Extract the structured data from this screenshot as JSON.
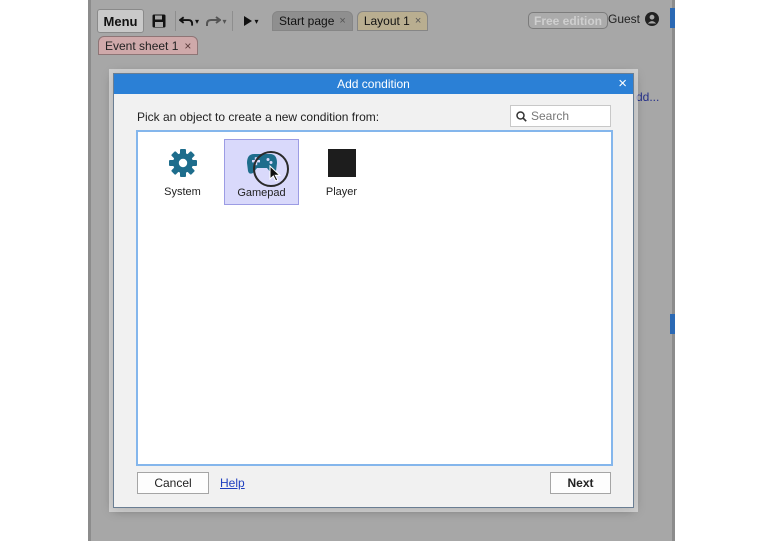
{
  "toolbar": {
    "menu_label": "Menu",
    "tabs": [
      {
        "label": "Start page",
        "close": "×"
      },
      {
        "label": "Layout 1",
        "close": "×"
      }
    ],
    "edition_badge": "Free edition",
    "user_label": "Guest"
  },
  "subtabs": [
    {
      "label": "Event sheet 1",
      "close": "×"
    }
  ],
  "background": {
    "add_link_fragment": "dd..."
  },
  "dialog": {
    "title": "Add condition",
    "close_glyph": "×",
    "prompt": "Pick an object to create a new condition from:",
    "search_placeholder": "Search",
    "objects": [
      {
        "label": "System",
        "icon": "gear-icon",
        "selected": false
      },
      {
        "label": "Gamepad",
        "icon": "gamepad-icon",
        "selected": true
      },
      {
        "label": "Player",
        "icon": "black-square-sprite-icon",
        "selected": false
      }
    ],
    "cancel_label": "Cancel",
    "help_label": "Help",
    "next_label": "Next"
  },
  "colors": {
    "title_bar": "#2b80d6",
    "selection_fill": "#d9d9fb",
    "list_border": "#84b6ec",
    "icon_teal": "#1e6d8c",
    "event_tab": "#cfa9aa",
    "layout_tab": "#b9ae90"
  }
}
